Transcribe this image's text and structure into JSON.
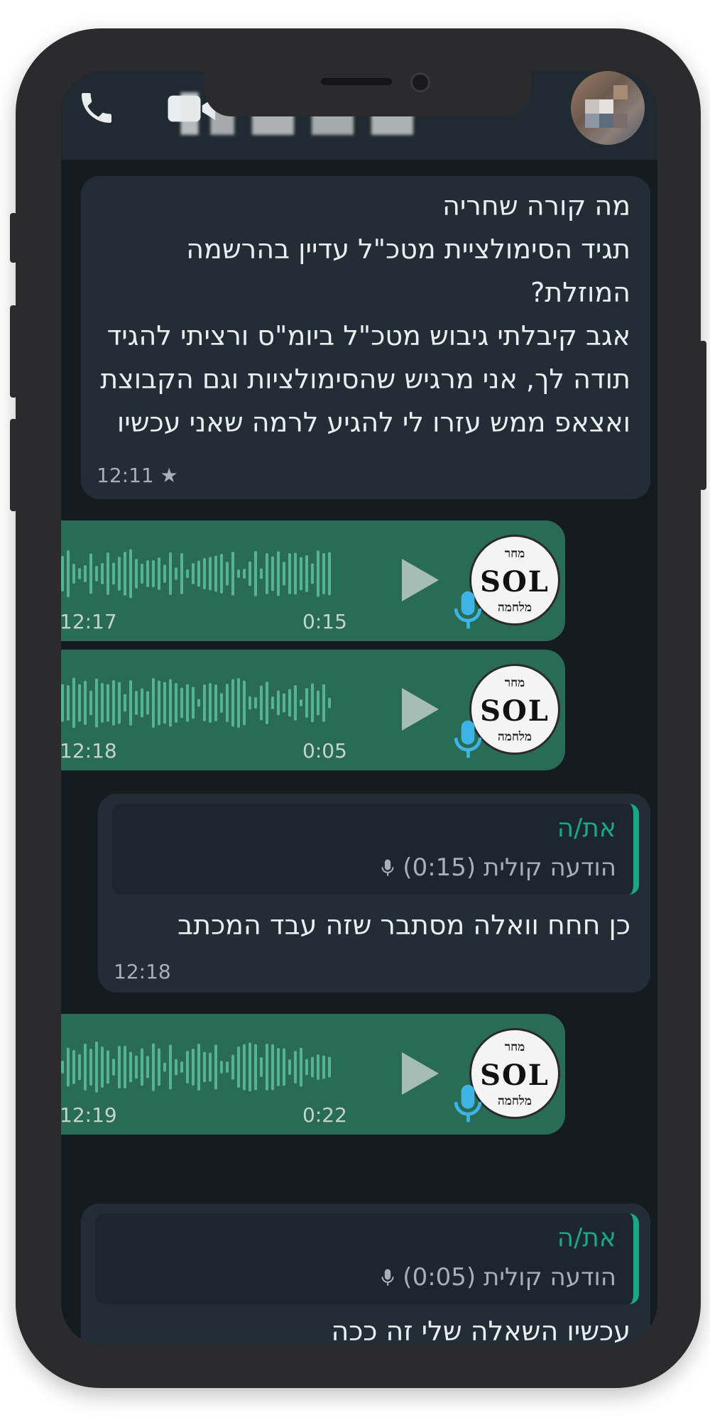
{
  "header": {
    "call_icon": "phone-icon",
    "video_icon": "video-icon"
  },
  "messages": {
    "m1": {
      "text": "מה קורה שחריה\nתגיד הסימולציית מטכ\"ל עדיין בהרשמה המוזלת?\nאגב קיבלתי גיבוש מטכ\"ל ביומ\"ס ורציתי להגיד תודה לך, אני מרגיש שהסימולציות וגם הקבוצת ואצאפ ממש עזרו לי להגיע לרמה שאני עכשיו",
      "time": "12:11",
      "star": "★"
    },
    "v1": {
      "duration": "0:15",
      "time": "12:17"
    },
    "v2": {
      "duration": "0:05",
      "time": "12:18"
    },
    "m2": {
      "reply_sender": "את/ה",
      "reply_desc": "הודעה קולית (0:15)",
      "text": "כן חחח וואלה מסתבר שזה עבד המכתב",
      "time": "12:18"
    },
    "v3": {
      "duration": "0:22",
      "time": "12:19"
    },
    "m3": {
      "reply_sender": "את/ה",
      "reply_desc": "הודעה קולית (0:05)",
      "text": "עכשיו השאלה שלי זה ככה"
    }
  },
  "logo": {
    "top": "מחר",
    "mid": "SOL",
    "bot": "מלחמה"
  },
  "colors": {
    "bubble_in": "#232d36",
    "voice_bubble": "#2a6b56",
    "accent": "#19a882",
    "background": "#141c22"
  }
}
